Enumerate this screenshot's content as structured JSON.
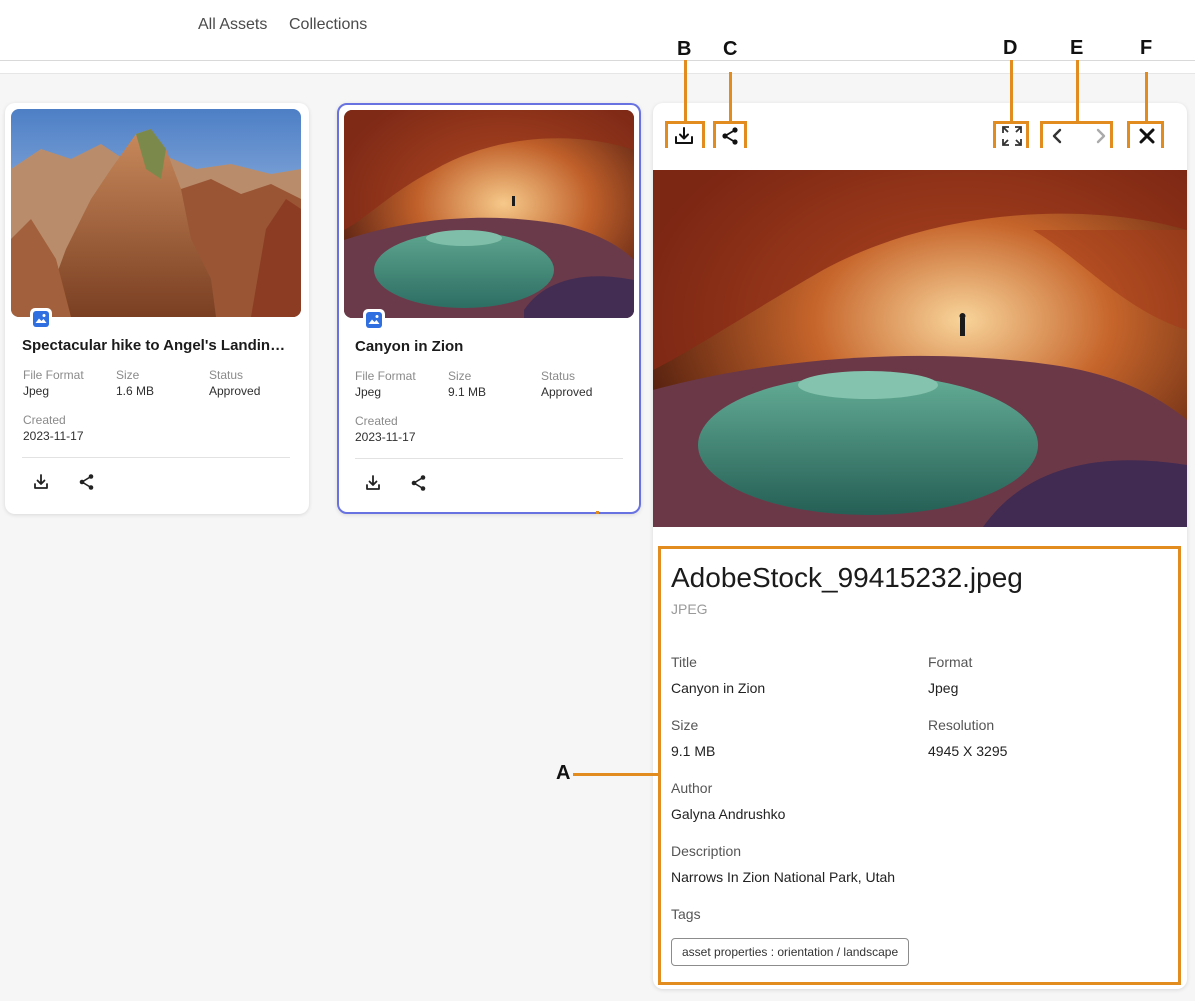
{
  "nav": {
    "all_assets": "All Assets",
    "collections": "Collections"
  },
  "cards": [
    {
      "title": "Spectacular hike to Angel's Landing i...",
      "file_format_label": "File Format",
      "file_format": "Jpeg",
      "size_label": "Size",
      "size": "1.6 MB",
      "status_label": "Status",
      "status": "Approved",
      "created_label": "Created",
      "created": "2023-11-17"
    },
    {
      "title": "Canyon in Zion",
      "file_format_label": "File Format",
      "file_format": "Jpeg",
      "size_label": "Size",
      "size": "9.1 MB",
      "status_label": "Status",
      "status": "Approved",
      "created_label": "Created",
      "created": "2023-11-17"
    }
  ],
  "details": {
    "filename": "AdobeStock_99415232.jpeg",
    "filetype": "JPEG",
    "title_label": "Title",
    "title": "Canyon in Zion",
    "format_label": "Format",
    "format": "Jpeg",
    "size_label": "Size",
    "size": "9.1 MB",
    "resolution_label": "Resolution",
    "resolution": "4945 X 3295",
    "author_label": "Author",
    "author": "Galyna Andrushko",
    "description_label": "Description",
    "description": "Narrows In Zion National Park, Utah",
    "tags_label": "Tags",
    "tags": [
      "asset properties : orientation / landscape"
    ]
  },
  "callouts": {
    "a": "A",
    "b": "B",
    "c": "C",
    "d": "D",
    "e": "E",
    "f": "F"
  },
  "colors": {
    "accent_highlight": "#e28b1f",
    "selected_border": "#6872e0",
    "badge_blue": "#2f6fe0"
  },
  "icons": [
    "image-type-icon",
    "download-icon",
    "share-icon",
    "fullscreen-icon",
    "chevron-left-icon",
    "chevron-right-icon",
    "close-icon"
  ]
}
